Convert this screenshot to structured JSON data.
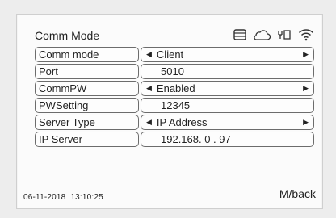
{
  "screen": {
    "title": "Comm Mode",
    "back_label": "M/back",
    "datetime": "06-11-2018  13:10:25"
  },
  "status_icons": [
    "memory-card-icon",
    "cloud-icon",
    "usb-icon",
    "wifi-icon"
  ],
  "rows": [
    {
      "label": "Comm mode",
      "value": "Client",
      "selectable": true
    },
    {
      "label": "Port",
      "value": "5010",
      "selectable": false
    },
    {
      "label": "CommPW",
      "value": "Enabled",
      "selectable": true
    },
    {
      "label": "PWSetting",
      "value": "12345",
      "selectable": false
    },
    {
      "label": "Server Type",
      "value": "IP Address",
      "selectable": true
    },
    {
      "label": "IP Server",
      "value": "192.168. 0 . 97",
      "selectable": false
    }
  ]
}
